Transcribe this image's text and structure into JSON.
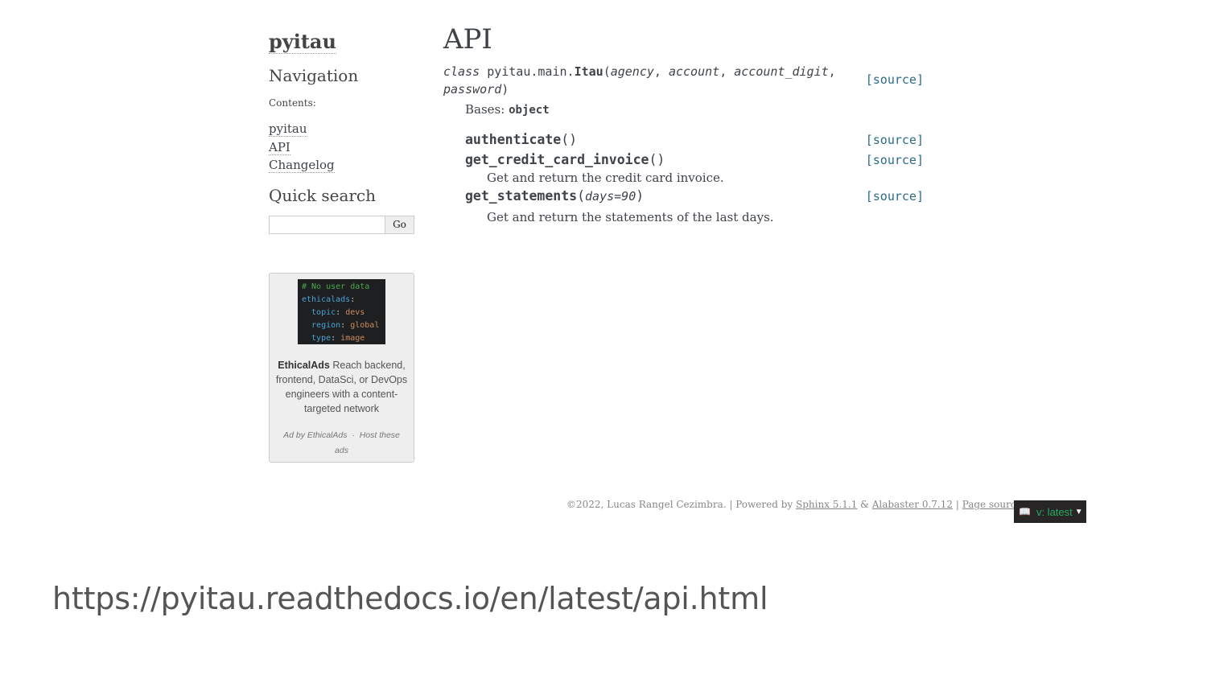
{
  "sidebar": {
    "logo": "pyitau",
    "navigation_title": "Navigation",
    "contents_caption": "Contents:",
    "toc": [
      "pyitau",
      "API",
      "Changelog"
    ],
    "quick_search_title": "Quick search",
    "search_value": "",
    "go_label": "Go"
  },
  "ad": {
    "code_lines": [
      "# No user data",
      "ethicalads:",
      "  topic: devs",
      "  region: global",
      "  type: image"
    ],
    "brand": "EthicalAds",
    "text": "Reach backend, frontend, DataSci, or DevOps engineers with a content-targeted network",
    "by": "Ad by EthicalAds",
    "sep": "·",
    "host": "Host these ads"
  },
  "main": {
    "title": "API",
    "class_sig": {
      "keyword": "class",
      "module": "pyitau.main.",
      "name": "Itau",
      "open": "(",
      "p1": "agency",
      "p2": "account",
      "p3": "account_digit",
      "p4": "password",
      "sep": ", ",
      "close": ")",
      "source": "[source]"
    },
    "bases_label": "Bases:",
    "bases_value": "object",
    "methods": [
      {
        "name": "authenticate",
        "params": "",
        "source": "[source]",
        "desc": ""
      },
      {
        "name": "get_credit_card_invoice",
        "params": "",
        "source": "[source]",
        "desc": "Get and return the credit card invoice."
      },
      {
        "name": "get_statements",
        "params": "days=90",
        "source": "[source]",
        "desc": "Get and return the statements of the last days."
      }
    ]
  },
  "footer": {
    "copyright": "©2022, Lucas Rangel Cezimbra. | Powered by",
    "sphinx": "Sphinx 5.1.1",
    "amp": "&",
    "alabaster": "Alabaster 0.7.12",
    "pipe": "|",
    "page_source": "Page source"
  },
  "rtd": {
    "version_label": "v: latest"
  },
  "url_caption": "https://pyitau.readthedocs.io/en/latest/api.html"
}
